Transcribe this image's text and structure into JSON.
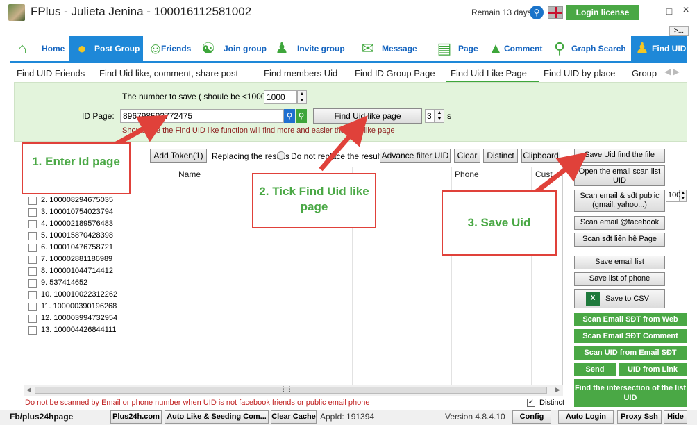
{
  "window": {
    "title": "FPlus - Julieta Jenina - 100016112581002",
    "remain": "Remain 13 days",
    "login_license": "Login license",
    "more": ">..."
  },
  "main_tabs": [
    {
      "label": "Home",
      "icon": "home-icon"
    },
    {
      "label": "Post Group",
      "icon": "group-icon"
    },
    {
      "label": "Friends",
      "icon": "friends-icon"
    },
    {
      "label": "Join group",
      "icon": "join-group-icon"
    },
    {
      "label": "Invite group",
      "icon": "invite-icon"
    },
    {
      "label": "Message",
      "icon": "message-icon"
    },
    {
      "label": "Page",
      "icon": "page-icon"
    },
    {
      "label": "Comment",
      "icon": "comment-icon"
    },
    {
      "label": "Graph Search",
      "icon": "search-icon"
    },
    {
      "label": "Find UID",
      "icon": "find-uid-icon"
    }
  ],
  "sub_tabs": [
    "Find UID Friends",
    "Find Uid like, comment, share post",
    "Find members Uid",
    "Find ID Group Page",
    "Find Uid Like Page",
    "Find UID by place",
    "Group"
  ],
  "form": {
    "save_count_label": "The number to save ( shoule be <10000)",
    "save_count": "1000",
    "id_page_label": "ID Page:",
    "id_page": "896798593772475",
    "find_button": "Find Uid like page",
    "threads": "3",
    "threads_unit": "s",
    "hint": "Should use the Find UID like function will find more and easier than the like page"
  },
  "toolbar": {
    "add_token": "Add Token(1)",
    "replace_label": "Replacing the results",
    "no_replace_label": "Do not replace the results",
    "advance_filter": "Advance filter UID",
    "clear": "Clear",
    "distinct": "Distinct",
    "clipboard": "Clipboard"
  },
  "grid": {
    "headers": [
      "Name",
      "Phone",
      "Cust"
    ],
    "rows": [
      "2. 100008294675035",
      "3. 100010754023794",
      "4. 100002189576483",
      "5. 100015870428398",
      "6. 100010476758721",
      "7. 100002881186989",
      "8. 100001044714412",
      "9. 537414652",
      "10. 100010022312262",
      "11. 100000390196268",
      "12. 100003994732954",
      "13. 100004426844111"
    ],
    "bottom_note": "Do not be scanned by Email or phone number when UID is not facebook friends or public email phone",
    "distinct_label": "Distinct"
  },
  "right_panel": {
    "save_uid_file": "Save Uid find the file",
    "open_email_scan": "Open the email scan list UID",
    "scan_gmail": "Scan email & sđt public (gmail, yahoo...)",
    "scan_gmail_count": "100",
    "scan_email_fb": "Scan email @facebook",
    "scan_contact_page": "Scan sđt liên hệ Page",
    "save_email_list": "Save email list",
    "save_phone_list": "Save list of phone",
    "save_csv": "Save to CSV",
    "excel_icon_text": "X",
    "scan_email_web": "Scan Email SĐT from Web",
    "scan_email_comment": "Scan Email SĐT Comment",
    "scan_uid_email": "Scan UID from Email SĐT",
    "send": "Send",
    "uid_from_link": "UID from Link",
    "intersection": "Find the intersection of the list UID"
  },
  "status_bar": {
    "fb_link": "Fb/plus24hpage",
    "plus24h": "Plus24h.com",
    "auto_like": "Auto Like & Seeding Com...",
    "clear_cache": "Clear Cache",
    "appid": "AppId: 191394",
    "version": "Version 4.8.4.10",
    "config": "Config",
    "auto_login": "Auto Login",
    "proxy_ssh": "Proxy Ssh",
    "hide": "Hide"
  },
  "annotations": {
    "step1": "1. Enter Id page",
    "step2": "2. Tick Find Uid like page",
    "step3": "3. Save Uid"
  },
  "colors": {
    "accent_blue": "#1e88d8",
    "brand_green": "#4aa845",
    "annotation_red": "#e0413a"
  }
}
